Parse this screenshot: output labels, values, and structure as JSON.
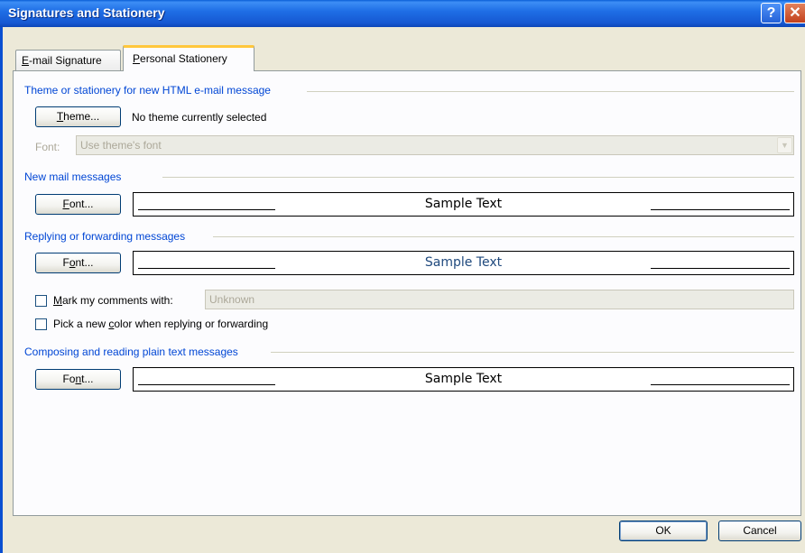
{
  "window": {
    "title": "Signatures and Stationery",
    "help_glyph": "?",
    "close_glyph": "✕"
  },
  "tabs": [
    {
      "label": "E-mail Signature",
      "access_key": "E",
      "rest": "-mail Signature",
      "selected": false
    },
    {
      "label": "Personal Stationery",
      "access_key": "P",
      "rest": "ersonal Stationery",
      "selected": true
    }
  ],
  "theme_group": {
    "title": "Theme or stationery for new HTML e-mail message",
    "theme_button": {
      "label": "Theme...",
      "access_key": "T",
      "rest": "heme..."
    },
    "status": "No theme currently selected",
    "font_label": "Font:",
    "font_value": "Use theme's font"
  },
  "new_mail": {
    "title": "New mail messages",
    "font_button": {
      "label": "Font...",
      "access_key": "F",
      "rest": "ont..."
    },
    "sample": "Sample Text",
    "sample_color": "#000000"
  },
  "replying": {
    "title": "Replying or forwarding messages",
    "font_button": {
      "label": "Font...",
      "pre": "F",
      "access_key": "o",
      "rest": "nt..."
    },
    "sample": "Sample Text",
    "sample_color": "#1f497d",
    "mark_comments": {
      "label": "Mark my comments with:",
      "access_key": "M",
      "rest": "ark my comments with:",
      "checked": false,
      "value": "Unknown"
    },
    "pick_color": {
      "label": "Pick a new color when replying or forwarding",
      "pre": "Pick a new ",
      "access_key": "c",
      "rest": "olor when replying or forwarding",
      "checked": false
    }
  },
  "plain_text": {
    "title": "Composing and reading plain text messages",
    "font_button": {
      "label": "Font...",
      "pre": "Fo",
      "access_key": "n",
      "rest": "t..."
    },
    "sample": "Sample Text",
    "sample_color": "#000000"
  },
  "footer": {
    "ok_label": "OK",
    "cancel_label": "Cancel"
  },
  "colors": {
    "group_title": "#0046d5",
    "titlebar": "#1f6fe6",
    "dialog_bg": "#ece9d8",
    "tab_highlight": "#ffc73c"
  }
}
